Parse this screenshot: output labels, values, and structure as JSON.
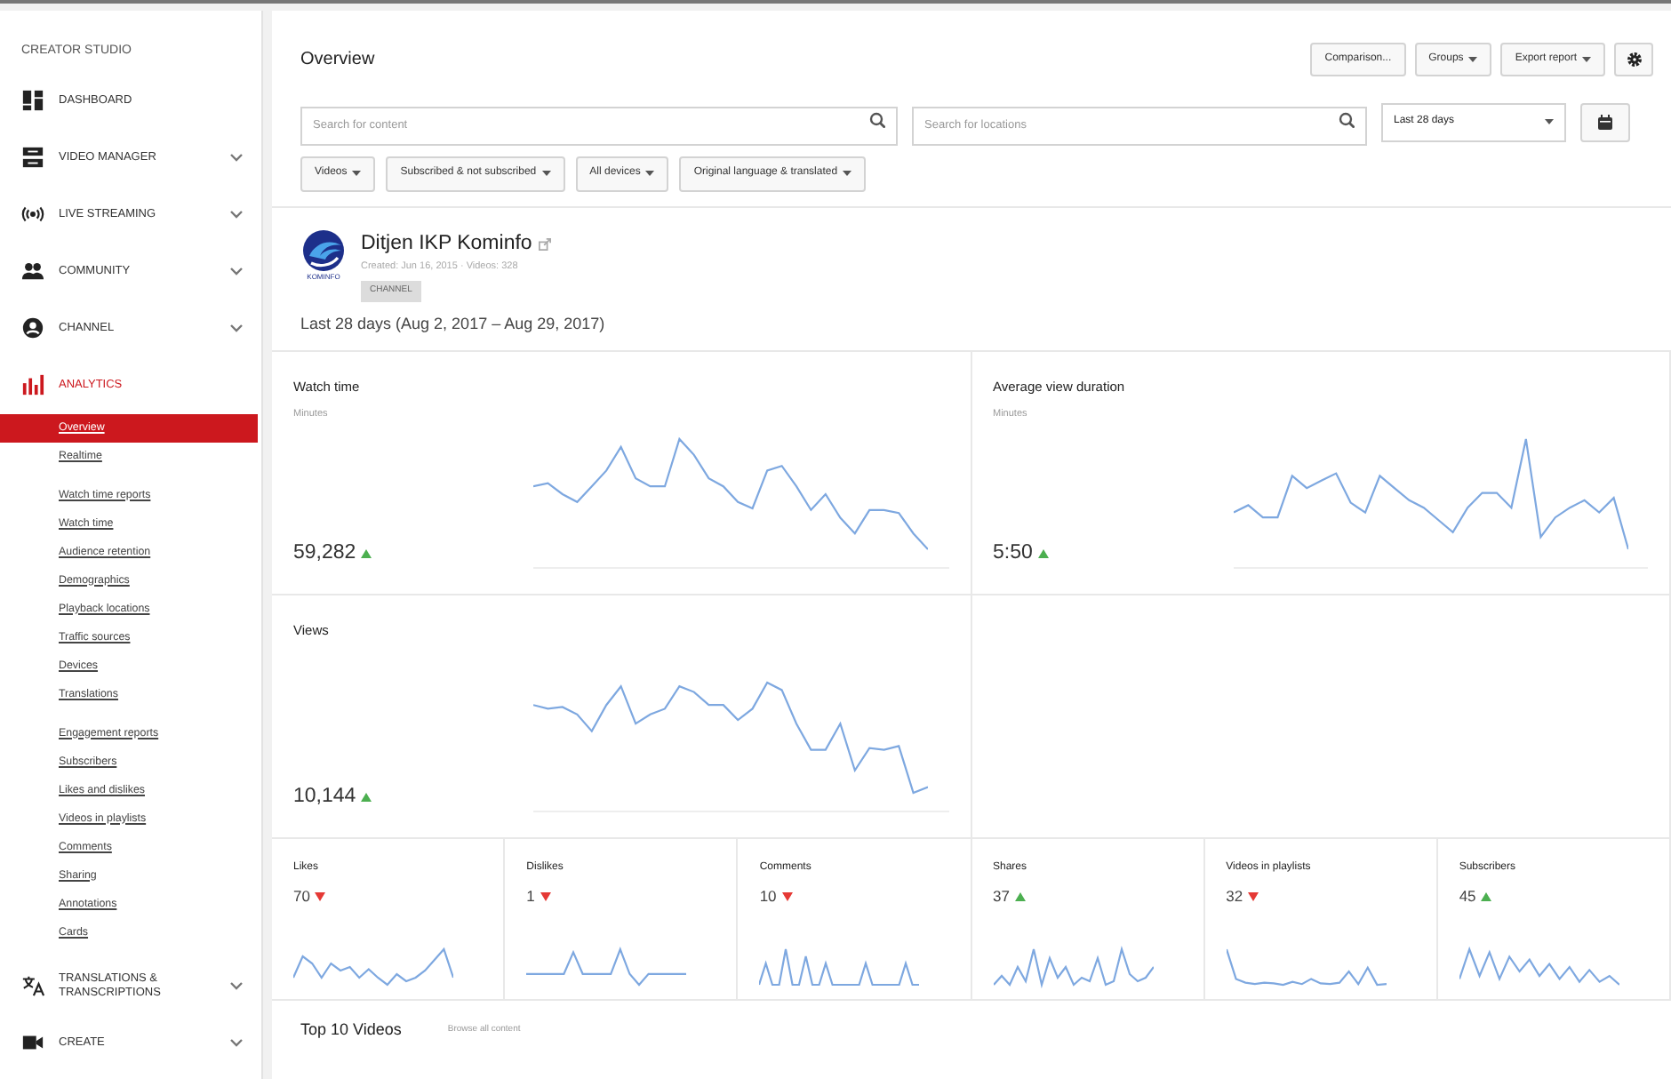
{
  "sidebar": {
    "title": "CREATOR STUDIO",
    "items": [
      {
        "kind": "dashboard",
        "label": "DASHBOARD",
        "selected": false,
        "expandable": false
      },
      {
        "kind": "video",
        "label": "VIDEO MANAGER",
        "selected": false,
        "expandable": true
      },
      {
        "kind": "live",
        "label": "LIVE STREAMING",
        "selected": false,
        "expandable": true
      },
      {
        "kind": "community",
        "label": "COMMUNITY",
        "selected": false,
        "expandable": true
      },
      {
        "kind": "channel",
        "label": "CHANNEL",
        "selected": false,
        "expandable": true
      },
      {
        "kind": "analytics",
        "label": "ANALYTICS",
        "selected": true,
        "expandable": false,
        "sections": [
          [
            {
              "label": "Overview",
              "selected": true
            },
            {
              "label": "Realtime",
              "selected": false
            }
          ],
          [
            {
              "label": "Watch time reports",
              "selected": false
            },
            {
              "label": "Watch time",
              "selected": false
            },
            {
              "label": "Audience retention",
              "selected": false
            },
            {
              "label": "Demographics",
              "selected": false
            },
            {
              "label": "Playback locations",
              "selected": false
            },
            {
              "label": "Traffic sources",
              "selected": false
            },
            {
              "label": "Devices",
              "selected": false
            },
            {
              "label": "Translations",
              "selected": false
            }
          ],
          [
            {
              "label": "Engagement reports",
              "selected": false
            },
            {
              "label": "Subscribers",
              "selected": false
            },
            {
              "label": "Likes and dislikes",
              "selected": false
            },
            {
              "label": "Videos in playlists",
              "selected": false
            },
            {
              "label": "Comments",
              "selected": false
            },
            {
              "label": "Sharing",
              "selected": false
            },
            {
              "label": "Annotations",
              "selected": false
            },
            {
              "label": "Cards",
              "selected": false
            }
          ]
        ]
      },
      {
        "kind": "translate",
        "label": "TRANSLATIONS & TRANSCRIPTIONS",
        "selected": false,
        "expandable": true
      },
      {
        "kind": "create",
        "label": "CREATE",
        "selected": false,
        "expandable": true
      }
    ]
  },
  "header": {
    "title": "Overview",
    "buttons": [
      {
        "label": "Comparison...",
        "dropdown": false
      },
      {
        "label": "Groups",
        "dropdown": true
      },
      {
        "label": "Export report",
        "dropdown": true
      }
    ]
  },
  "filters": {
    "content_search": {
      "placeholder": "Search for content"
    },
    "location_search": {
      "placeholder": "Search for locations"
    },
    "date_range": "Last 28 days",
    "dropdowns": [
      "Videos",
      "Subscribed & not subscribed",
      "All devices",
      "Original language & translated"
    ]
  },
  "channel": {
    "name": "Ditjen IKP Kominfo",
    "logo_text": "KOMINFO",
    "meta": "Created: Jun 16, 2015 · Videos: 328",
    "tag": "CHANNEL",
    "period": "Last 28 days (Aug 2, 2017 – Aug 29, 2017)"
  },
  "main_metrics": [
    {
      "title": "Watch time",
      "unit": "Minutes",
      "value": "59,282",
      "increase": true
    },
    {
      "title": "Average view duration",
      "unit": "Minutes",
      "value": "5:50",
      "increase": true
    },
    {
      "title": "Views",
      "value": "10,144",
      "increase": true
    }
  ],
  "small_metrics": [
    {
      "title": "Likes",
      "value": "70",
      "increase": false
    },
    {
      "title": "Dislikes",
      "value": "1",
      "increase": false
    },
    {
      "title": "Comments",
      "value": "10",
      "increase": false
    },
    {
      "title": "Shares",
      "value": "37",
      "increase": true
    },
    {
      "title": "Videos in playlists",
      "value": "32",
      "increase": false
    },
    {
      "title": "Subscribers",
      "value": "45",
      "increase": true
    }
  ],
  "top_videos": {
    "title": "Top 10 Videos",
    "link": "Browse all content"
  }
}
